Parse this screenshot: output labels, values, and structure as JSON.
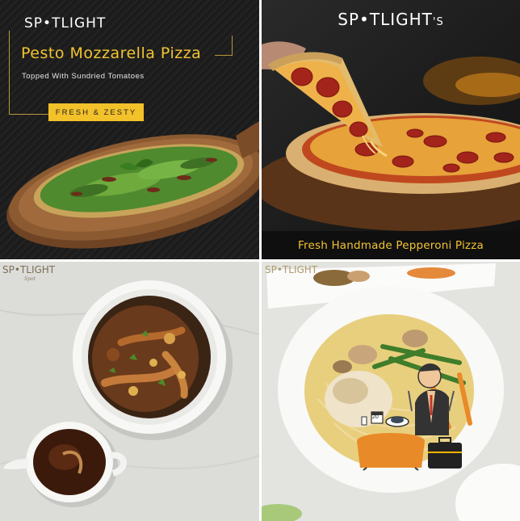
{
  "tiles": {
    "top_left": {
      "logo": "SP•TLIGHT",
      "title": "Pesto Mozzarella Pizza",
      "subtitle": "Topped With Sundried Tomatoes",
      "badge": "FRESH & ZESTY"
    },
    "top_right": {
      "logo": "SP•TLIGHT",
      "logo_suffix": "'S",
      "caption": "Fresh Handmade Pepperoni Pizza"
    },
    "bottom_left": {
      "logo": "SP•TLIGHT",
      "logo_sub": "Spot"
    },
    "bottom_right": {
      "logo": "SP•TLIGHT",
      "sticker_number": "20"
    }
  },
  "colors": {
    "accent_gold": "#f3c430",
    "dark_bg": "#1a1a1a",
    "wood": "#8a5a32",
    "pesto_green": "#5f9a3a",
    "pepperoni_red": "#a3241b"
  },
  "icons": [
    "dining-man-icon",
    "briefcase-icon",
    "cutlery-plate-icon"
  ]
}
